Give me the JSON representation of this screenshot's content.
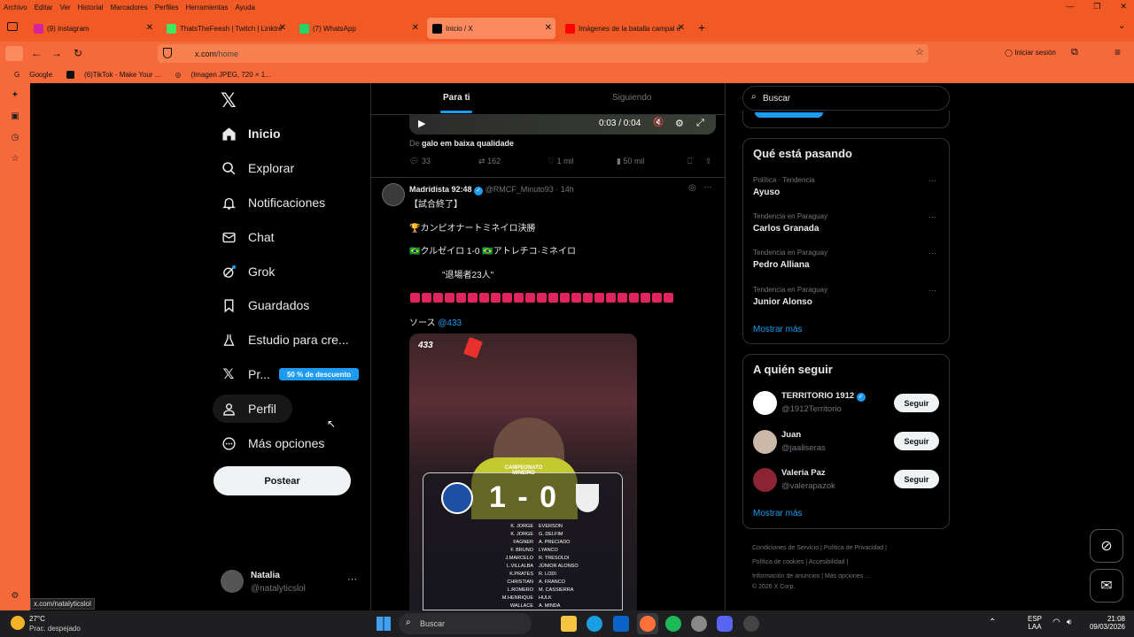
{
  "menubar": {
    "items": [
      "Archivo",
      "Editar",
      "Ver",
      "Historial",
      "Marcadores",
      "Perfiles",
      "Herramientas",
      "Ayuda"
    ]
  },
  "tabs": [
    {
      "label": "(9) Instagram",
      "color": "#d6249f"
    },
    {
      "label": "ThatsTheFeesh | Twitch | Linktre",
      "color": "#43e55e"
    },
    {
      "label": "(7) WhatsApp",
      "color": "#25d366"
    },
    {
      "label": "Inicio / X",
      "color": "#000000"
    },
    {
      "label": "Imágenes de la batalla campal e",
      "color": "#ff0000"
    }
  ],
  "address": {
    "host": "x.com",
    "path": "/home",
    "signin": "Iniciar sesión"
  },
  "bookmarks": [
    "Google",
    "(6)TikTok - Make Your ...",
    "(Imagen JPEG, 720 × 1..."
  ],
  "nav": {
    "items": [
      "Inicio",
      "Explorar",
      "Notificaciones",
      "Chat",
      "Grok",
      "Guardados",
      "Estudio para cre...",
      "Pr...",
      "Perfil",
      "Más opciones"
    ],
    "premium_badge": "50 % de descuento",
    "post_button": "Postear"
  },
  "account": {
    "name": "Natalia",
    "handle": "@natalyticslol"
  },
  "status_url": "x.com/natalyticslol",
  "feed": {
    "tabs": [
      "Para ti",
      "Siguiendo"
    ],
    "video_time": "0:03 / 0:04",
    "from_prefix": "De",
    "from_text": "galo em baixa qualidade",
    "actions1": {
      "replies": "33",
      "reposts": "162",
      "likes": "1 mil",
      "views": "50 mil"
    },
    "tweet": {
      "name": "Madridista 92:48",
      "handle": "@RMCF_Minuto93 · 14h",
      "line1": "【試合終了】",
      "line2": "🏆カンピオナートミネイロ決勝",
      "line3": "🇧🇷クルゼイロ 1-0 🇧🇷アトレチコ·ミネイロ",
      "line4": "\"退場者23人\"",
      "source_prefix": "ソース",
      "source_link": "@433",
      "card_brand": "433",
      "card_label": "CAMPEONATO MINEIRO",
      "score": "1 - 0",
      "lineup_left": [
        "K. JORGE",
        "K. JORGE",
        "FAGNER",
        "F. BRUNO",
        "J.MARCELO",
        "L.VILLALBA",
        "K.PRATES",
        "CHRISTIAN",
        "L.ROMERO",
        "M.HENRIQUE",
        "WALLACE"
      ],
      "lineup_right": [
        "EVERSON",
        "G. DELFIM",
        "A. PRECIADO",
        "LYANCO",
        "R. TRESOLDI",
        "JÚNIOR ALONSO",
        "R. LODI",
        "A. FRANCO",
        "M. CASSIERRA",
        "HULK",
        "A. MINDA"
      ]
    }
  },
  "search_placeholder": "Buscar",
  "trends": {
    "title": "Qué está pasando",
    "items": [
      {
        "cat": "Política · Tendencia",
        "name": "Ayuso"
      },
      {
        "cat": "Tendencia en Paraguay",
        "name": "Carlos Granada"
      },
      {
        "cat": "Tendencia en Paraguay",
        "name": "Pedro Alliana"
      },
      {
        "cat": "Tendencia en Paraguay",
        "name": "Junior Alonso"
      }
    ],
    "more": "Mostrar más"
  },
  "follow": {
    "title": "A quién seguir",
    "items": [
      {
        "name": "TERRITORIO 1912",
        "handle": "@1912Territorio"
      },
      {
        "name": "Juan",
        "handle": "@jaaliseras"
      },
      {
        "name": "Valeria Paz",
        "handle": "@valerapazok"
      }
    ],
    "button": "Seguir",
    "more": "Mostrar más"
  },
  "footer": {
    "links": [
      "Condiciones de Servicio",
      "Política de Privacidad",
      "Política de cookies",
      "Accesibilidad",
      "Información de anuncios",
      "Más opciones ...",
      "© 2026 X Corp."
    ]
  },
  "taskbar": {
    "temp": "27°C",
    "weather": "Prac. despejado",
    "search": "Buscar",
    "lang1": "ESP",
    "lang2": "LAA",
    "time": "21:08",
    "date": "09/03/2026"
  },
  "colors": {
    "accent": "#1d9bf0",
    "browser": "#f25a25",
    "seguir_bg": "#eff3f4"
  }
}
